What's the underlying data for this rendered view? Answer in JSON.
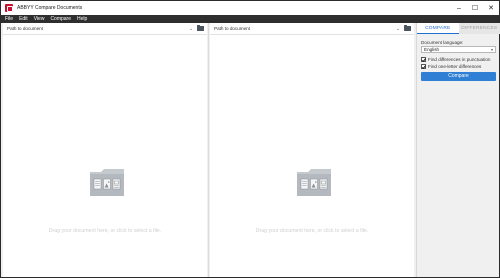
{
  "window": {
    "title": "ABBYY Compare Documents",
    "controls": {
      "minimize": "–",
      "maximize": "☐",
      "close": "✕"
    }
  },
  "menu": [
    "File",
    "Edit",
    "View",
    "Compare",
    "Help"
  ],
  "panes": {
    "left": {
      "path_placeholder": "Path to document",
      "drop_text": "Drag your document here, or click to select a file."
    },
    "right": {
      "path_placeholder": "Path to document",
      "drop_text": "Drag your document here, or click to select a file."
    }
  },
  "side_panel": {
    "tabs": [
      {
        "label": "COMPARE",
        "active": true
      },
      {
        "label": "DIFFERENCES",
        "active": false
      }
    ],
    "language_label": "Document language:",
    "language_value": "English",
    "options": [
      {
        "label": "Find differences in punctuation",
        "checked": true
      },
      {
        "label": "Find one-letter differences",
        "checked": true
      }
    ],
    "compare_button": "Compare"
  },
  "icons": {
    "app": "abbyy-app-icon",
    "folder": "folder-icon",
    "chevron": "chevron-down-icon",
    "document_folder": "document-folder-illustration"
  },
  "colors": {
    "accent": "#2f7fd4",
    "menubar": "#2e2e2e",
    "brand_red": "#c8102e"
  }
}
